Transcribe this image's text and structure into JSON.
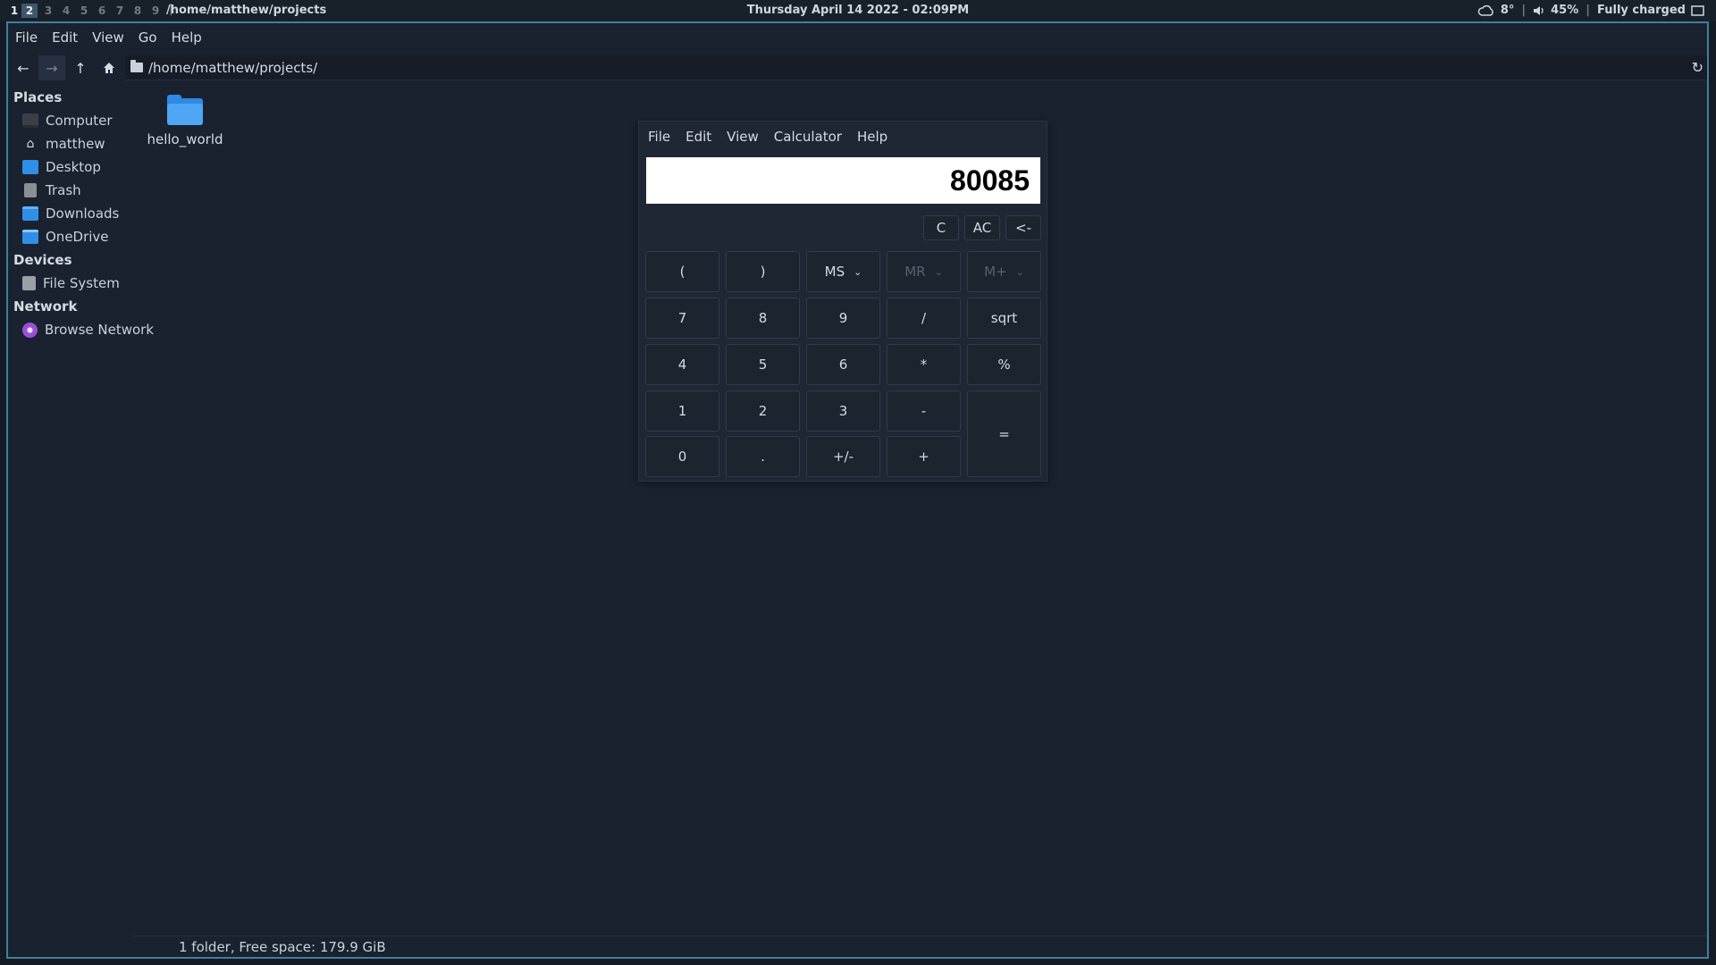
{
  "topbar": {
    "workspaces": [
      "1",
      "2",
      "3",
      "4",
      "5",
      "6",
      "7",
      "8",
      "9"
    ],
    "active_workspace": "2",
    "path": "/home/matthew/projects",
    "clock": "Thursday April 14 2022 - 02:09PM",
    "weather": "8°",
    "volume": "45%",
    "battery": "Fully charged"
  },
  "fm": {
    "menu": [
      "File",
      "Edit",
      "View",
      "Go",
      "Help"
    ],
    "location": "/home/matthew/projects/",
    "sidebar": {
      "places_heading": "Places",
      "places": [
        {
          "label": "Computer",
          "icon": "computer-icon"
        },
        {
          "label": "matthew",
          "icon": "home-icon"
        },
        {
          "label": "Desktop",
          "icon": "desktop-folder-icon"
        },
        {
          "label": "Trash",
          "icon": "trash-icon"
        },
        {
          "label": "Downloads",
          "icon": "downloads-folder-icon"
        },
        {
          "label": "OneDrive",
          "icon": "onedrive-folder-icon"
        }
      ],
      "devices_heading": "Devices",
      "devices": [
        {
          "label": "File System",
          "icon": "drive-icon"
        }
      ],
      "network_heading": "Network",
      "network": [
        {
          "label": "Browse Network",
          "icon": "network-icon"
        }
      ]
    },
    "files": [
      {
        "name": "hello_world",
        "icon": "folder-icon"
      }
    ],
    "status": "1 folder, Free space: 179.9 GiB"
  },
  "calc": {
    "menu": [
      "File",
      "Edit",
      "View",
      "Calculator",
      "Help"
    ],
    "display": "80085",
    "top_buttons": [
      "C",
      "AC",
      "<-"
    ],
    "row1": [
      "(",
      ")",
      "MS",
      "MR",
      "M+"
    ],
    "row2": [
      "7",
      "8",
      "9",
      "/",
      "sqrt"
    ],
    "row3": [
      "4",
      "5",
      "6",
      "*",
      "%"
    ],
    "row4": [
      "1",
      "2",
      "3",
      "-"
    ],
    "row5": [
      "0",
      ".",
      "+/-",
      "+"
    ],
    "equals": "="
  },
  "colors": {
    "background": "#141b24",
    "window_border": "#3f7f9e",
    "folder_blue": "#2e8ae6"
  }
}
